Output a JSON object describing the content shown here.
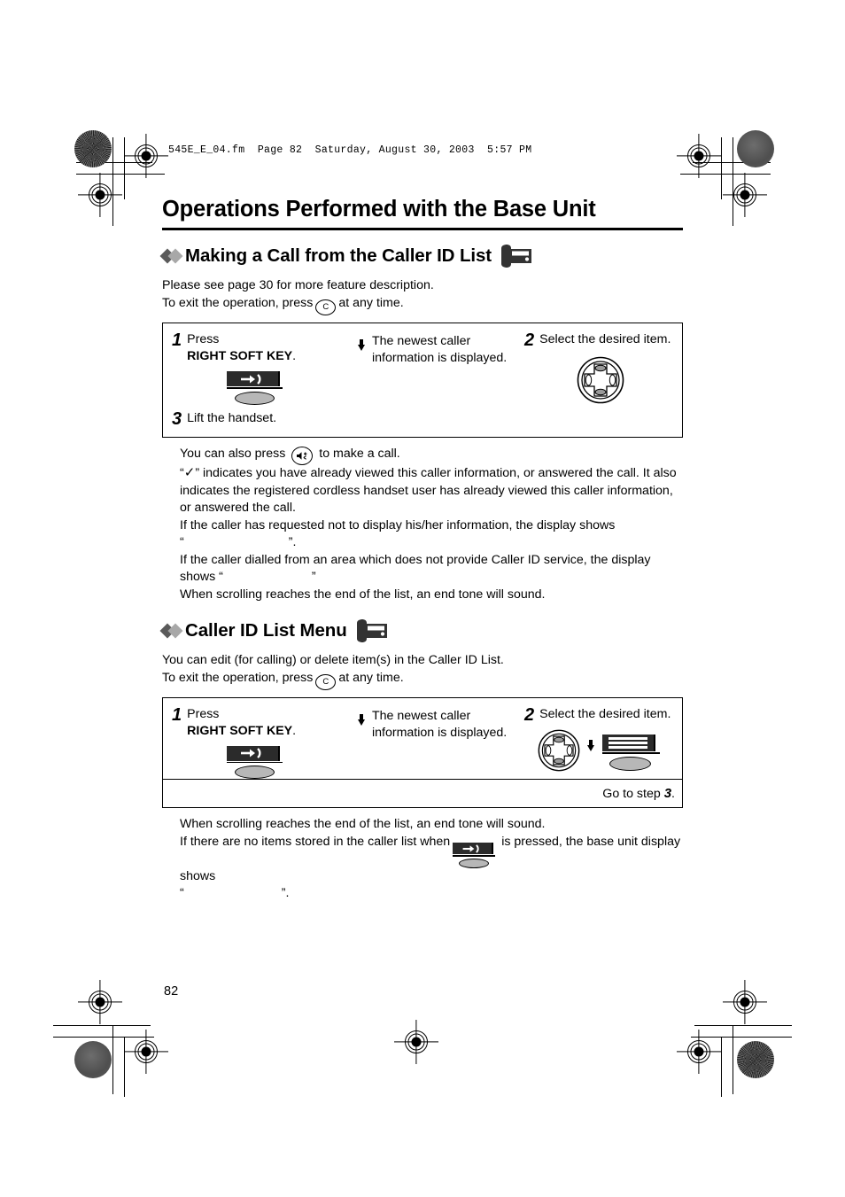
{
  "file_stamp": "545E_E_04.fm  Page 82  Saturday, August 30, 2003  5:57 PM",
  "page_title": "Operations Performed with the Base Unit",
  "page_number": "82",
  "sections": [
    {
      "heading": "Making a Call from the Caller ID List",
      "heading_icon": "base-unit-icon",
      "intro": [
        "Please see page 30 for more feature description.",
        "To exit the operation, press",
        "at any time."
      ],
      "exit_key_label": "C",
      "steps": {
        "step1_num": "1",
        "step1_line1": "Press",
        "step1_line2_bold": "RIGHT SOFT KEY",
        "step1_line2_tail": ".",
        "step1_key": "right-soft-key",
        "result_line1": "The newest caller",
        "result_line2": "information is displayed.",
        "step2_num": "2",
        "step2_text": "Select the desired item.",
        "step2_key": "navigator-joystick",
        "step3_num": "3",
        "step3_text": "Lift the handset."
      },
      "notes": [
        {
          "prefix": "You can also press",
          "icon": "speakerphone-key",
          "suffix": "to make a call."
        },
        {
          "text_1": "“",
          "check": "✓",
          "text_2": "” indicates you have already viewed this caller information, or answered the call. It also indicates the registered cordless handset user has already viewed this caller information, or answered the call."
        },
        {
          "text_1": "If the caller has requested not to display his/her information, the display shows",
          "quote_open": "“",
          "quote_value": "",
          "quote_close": "”."
        },
        {
          "text_1": "If the caller dialled from an area which does not provide Caller ID service, the display shows",
          "quote_open": "“",
          "quote_value": "",
          "quote_close": "”"
        },
        {
          "text_1": "When scrolling reaches the end of the list, an end tone will sound."
        }
      ]
    },
    {
      "heading": "Caller ID List Menu",
      "heading_icon": "base-unit-icon",
      "intro": [
        "You can edit (for calling) or delete item(s) in the Caller ID List.",
        "To exit the operation, press",
        "at any time."
      ],
      "exit_key_label": "C",
      "steps": {
        "step1_num": "1",
        "step1_line1": "Press",
        "step1_line2_bold": "RIGHT SOFT KEY",
        "step1_line2_tail": ".",
        "step1_key": "right-soft-key",
        "result_line1": "The newest caller",
        "result_line2": "information is displayed.",
        "step2_num": "2",
        "step2_text": "Select the desired item.",
        "step2_key_a": "navigator-joystick",
        "step2_key_b": "menu-soft-key",
        "footer_text": "Go to step",
        "footer_step": "3",
        "footer_tail": "."
      },
      "notes": [
        {
          "text_1": "When scrolling reaches the end of the list, an end tone will sound."
        },
        {
          "prefix": "If there are no items stored in the caller list when",
          "icon": "right-soft-key",
          "suffix": "is pressed, the base unit display shows",
          "quote_open": "“",
          "quote_value": "",
          "quote_close": "”."
        }
      ]
    }
  ],
  "colors": {
    "text": "#000000",
    "diamond_dark": "#5a5a5a",
    "diamond_light": "#a8a8a8",
    "key_face": "#2b2b2b",
    "key_pad": "#b7b7b7",
    "background": "#ffffff"
  }
}
